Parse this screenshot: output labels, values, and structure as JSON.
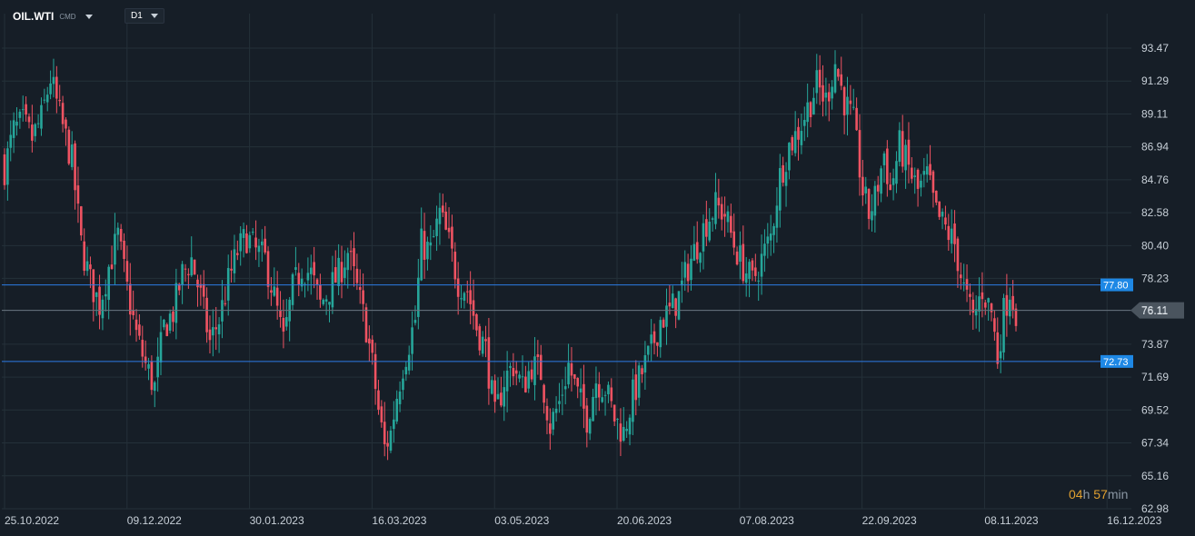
{
  "header": {
    "symbol": "OIL.WTI",
    "symbol_suffix": "CMD",
    "timeframe": "D1"
  },
  "countdown": {
    "hours": "04",
    "hours_unit": "h",
    "minutes": "57",
    "minutes_unit": "min"
  },
  "colors": {
    "background": "#161e27",
    "grid": "#243039",
    "bull": "#26a69a",
    "bear": "#ef5362",
    "hline": "#2c7be5",
    "label_blue": "#1e88e5",
    "current_price_bg": "#4a545e",
    "countdown": "#e0a030"
  },
  "chart_data": {
    "type": "candlestick",
    "title": "",
    "xlabel": "",
    "ylabel": "",
    "ylim": [
      62.98,
      94.6
    ],
    "y_ticks": [
      "93.47",
      "91.29",
      "89.11",
      "86.94",
      "84.76",
      "82.58",
      "80.40",
      "78.23",
      "76.11",
      "73.87",
      "71.69",
      "69.52",
      "67.34",
      "65.16",
      "62.98"
    ],
    "x_tick_labels": [
      "25.10.2022",
      "09.12.2022",
      "30.01.2023",
      "16.03.2023",
      "03.05.2023",
      "20.06.2023",
      "07.08.2023",
      "22.09.2023",
      "08.11.2023",
      "16.12.2023"
    ],
    "grid": true,
    "horizontal_lines": [
      {
        "value": 77.8,
        "label": "77.80",
        "style": "blue"
      },
      {
        "value": 76.11,
        "label": "76.11",
        "style": "current"
      },
      {
        "value": 72.73,
        "label": "72.73",
        "style": "blue"
      }
    ],
    "close_path": [
      [
        0,
        85.5
      ],
      [
        3,
        88.0
      ],
      [
        6,
        88.5
      ],
      [
        9,
        87.5
      ],
      [
        12,
        88.8
      ],
      [
        15,
        91.5
      ],
      [
        18,
        89.0
      ],
      [
        22,
        86.0
      ],
      [
        25,
        80.5
      ],
      [
        28,
        78.0
      ],
      [
        31,
        76.5
      ],
      [
        34,
        79.0
      ],
      [
        37,
        81.0
      ],
      [
        40,
        77.5
      ],
      [
        43,
        74.5
      ],
      [
        46,
        72.5
      ],
      [
        49,
        71.0
      ],
      [
        52,
        75.0
      ],
      [
        55,
        76.0
      ],
      [
        58,
        78.5
      ],
      [
        61,
        79.5
      ],
      [
        64,
        77.0
      ],
      [
        67,
        74.0
      ],
      [
        70,
        75.5
      ],
      [
        73,
        78.0
      ],
      [
        76,
        80.0
      ],
      [
        79,
        81.0
      ],
      [
        82,
        80.0
      ],
      [
        85,
        79.5
      ],
      [
        88,
        77.0
      ],
      [
        91,
        74.0
      ],
      [
        94,
        77.5
      ],
      [
        97,
        79.0
      ],
      [
        100,
        78.5
      ],
      [
        103,
        76.5
      ],
      [
        106,
        77.5
      ],
      [
        109,
        78.5
      ],
      [
        112,
        80.0
      ],
      [
        115,
        77.5
      ],
      [
        118,
        75.0
      ],
      [
        120,
        72.5
      ],
      [
        122,
        69.5
      ],
      [
        124,
        67.0
      ],
      [
        126,
        68.0
      ],
      [
        128,
        70.5
      ],
      [
        130,
        72.5
      ],
      [
        132,
        74.0
      ],
      [
        134,
        75.5
      ],
      [
        136,
        80.5
      ],
      [
        139,
        80.0
      ],
      [
        142,
        82.5
      ],
      [
        145,
        80.5
      ],
      [
        148,
        78.0
      ],
      [
        151,
        77.5
      ],
      [
        154,
        75.0
      ],
      [
        157,
        73.5
      ],
      [
        160,
        69.0
      ],
      [
        163,
        71.5
      ],
      [
        166,
        72.5
      ],
      [
        169,
        71.0
      ],
      [
        172,
        72.5
      ],
      [
        175,
        72.0
      ],
      [
        178,
        68.5
      ],
      [
        181,
        70.0
      ],
      [
        184,
        72.5
      ],
      [
        187,
        70.5
      ],
      [
        190,
        69.0
      ],
      [
        193,
        71.5
      ],
      [
        196,
        71.0
      ],
      [
        199,
        69.0
      ],
      [
        202,
        68.0
      ],
      [
        205,
        70.5
      ],
      [
        208,
        72.0
      ],
      [
        211,
        73.5
      ],
      [
        214,
        75.5
      ],
      [
        217,
        76.0
      ],
      [
        220,
        77.0
      ],
      [
        223,
        79.0
      ],
      [
        226,
        80.5
      ],
      [
        229,
        82.0
      ],
      [
        232,
        83.0
      ],
      [
        235,
        82.5
      ],
      [
        238,
        80.5
      ],
      [
        241,
        79.0
      ],
      [
        244,
        78.0
      ],
      [
        247,
        79.5
      ],
      [
        250,
        81.0
      ],
      [
        253,
        85.0
      ],
      [
        256,
        87.0
      ],
      [
        259,
        88.0
      ],
      [
        262,
        89.5
      ],
      [
        265,
        91.0
      ],
      [
        268,
        90.0
      ],
      [
        271,
        92.5
      ],
      [
        274,
        90.0
      ],
      [
        277,
        88.5
      ],
      [
        280,
        84.0
      ],
      [
        282,
        82.5
      ],
      [
        284,
        83.5
      ],
      [
        287,
        86.5
      ],
      [
        289,
        84.0
      ],
      [
        292,
        87.0
      ],
      [
        295,
        85.5
      ],
      [
        298,
        84.0
      ],
      [
        301,
        85.0
      ],
      [
        304,
        82.5
      ],
      [
        307,
        81.5
      ],
      [
        310,
        80.5
      ],
      [
        313,
        77.5
      ],
      [
        316,
        75.5
      ],
      [
        319,
        77.5
      ],
      [
        322,
        76.0
      ],
      [
        324,
        73.0
      ],
      [
        326,
        76.0
      ],
      [
        328,
        77.5
      ],
      [
        330,
        76.11
      ]
    ]
  }
}
